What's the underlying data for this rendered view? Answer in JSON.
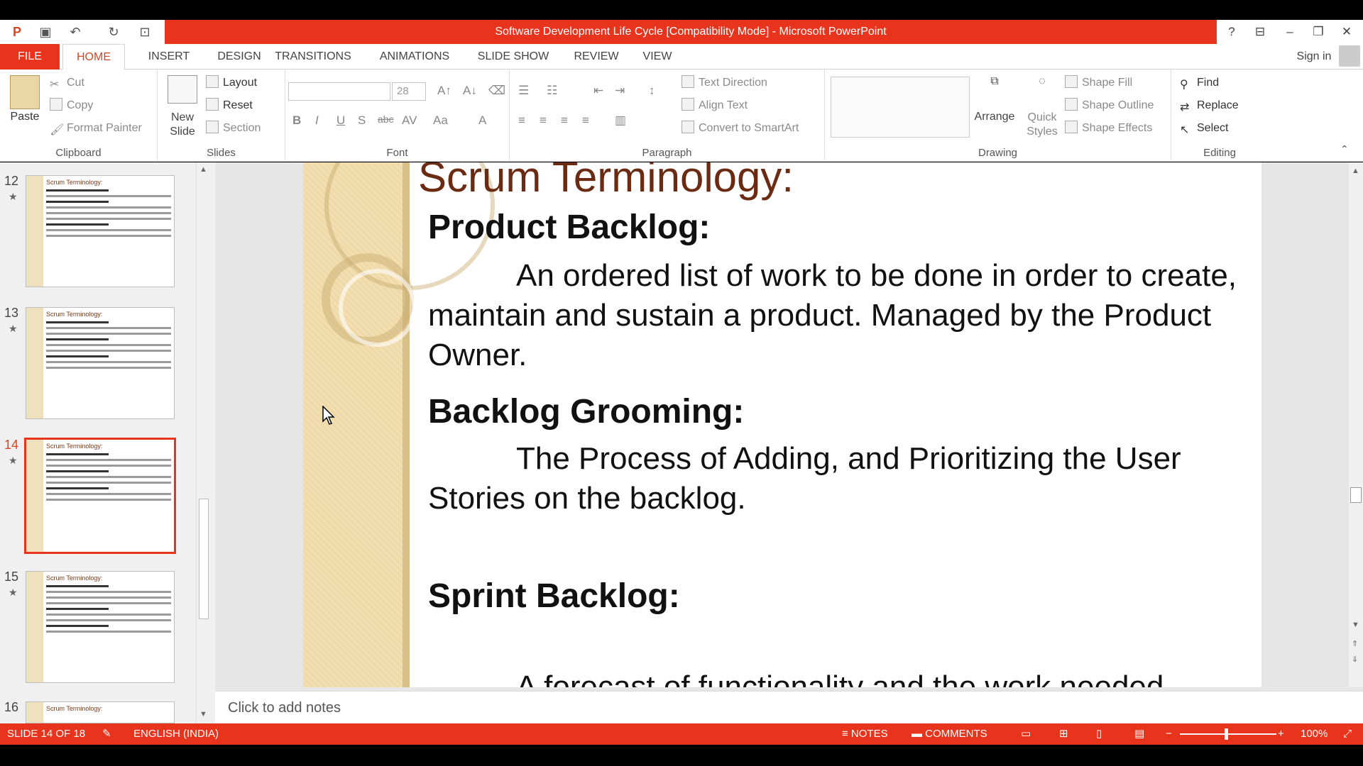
{
  "window": {
    "title": "Software Development Life Cycle [Compatibility Mode] - Microsoft PowerPoint",
    "help": "?",
    "sign_in": "Sign in"
  },
  "tabs": [
    "FILE",
    "HOME",
    "INSERT",
    "DESIGN",
    "TRANSITIONS",
    "ANIMATIONS",
    "SLIDE SHOW",
    "REVIEW",
    "VIEW"
  ],
  "ribbon": {
    "clipboard": {
      "label": "Clipboard",
      "paste": "Paste",
      "cut": "Cut",
      "copy": "Copy",
      "format_painter": "Format Painter"
    },
    "slides": {
      "label": "Slides",
      "new_slide_1": "New",
      "new_slide_2": "Slide",
      "layout": "Layout",
      "reset": "Reset",
      "section": "Section"
    },
    "font": {
      "label": "Font",
      "font_name": "",
      "font_size": "28",
      "bold": "B",
      "italic": "I",
      "underline": "U",
      "shadow": "S",
      "strike": "abc",
      "spacing": "AV",
      "case": "Aa",
      "color": "A"
    },
    "paragraph": {
      "label": "Paragraph",
      "text_direction": "Text Direction",
      "align_text": "Align Text",
      "convert_smartart": "Convert to SmartArt"
    },
    "drawing": {
      "label": "Drawing",
      "arrange": "Arrange",
      "quick_styles_1": "Quick",
      "quick_styles_2": "Styles",
      "shape_fill": "Shape Fill",
      "shape_outline": "Shape Outline",
      "shape_effects": "Shape Effects"
    },
    "editing": {
      "label": "Editing",
      "find": "Find",
      "replace": "Replace",
      "select": "Select"
    }
  },
  "thumbnails": [
    {
      "num": "12",
      "title": "Scrum Terminology:"
    },
    {
      "num": "13",
      "title": "Scrum Terminology:"
    },
    {
      "num": "14",
      "title": "Scrum Terminology:"
    },
    {
      "num": "15",
      "title": "Scrum Terminology:"
    },
    {
      "num": "16",
      "title": "Scrum Terminology:"
    }
  ],
  "slide": {
    "title": "Scrum Terminology:",
    "sections": [
      {
        "heading": "Product Backlog:",
        "body": "An ordered list of work to be done in order to create, maintain and sustain a product. Managed by the Product Owner."
      },
      {
        "heading": "Backlog Grooming:",
        "body": "The Process of Adding, and Prioritizing the User Stories on the backlog."
      },
      {
        "heading": "Sprint Backlog:",
        "body": "A forecast of functionality and the work needed"
      }
    ]
  },
  "notes_placeholder": "Click to add notes",
  "status": {
    "slide_pos": "SLIDE 14 OF 18",
    "language": "ENGLISH (INDIA)",
    "notes": "NOTES",
    "comments": "COMMENTS",
    "zoom": "100%"
  }
}
